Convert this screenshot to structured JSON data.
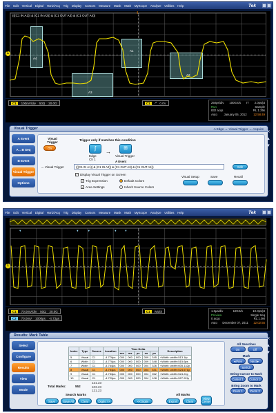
{
  "menu": {
    "items": [
      "File",
      "Edit",
      "Vertical",
      "Digital",
      "Horiz/Acq",
      "Trig",
      "Display",
      "Cursors",
      "Measure",
      "Mask",
      "Math",
      "MyScope",
      "Analyze",
      "Utilities",
      "Help"
    ],
    "brand": "Tek"
  },
  "screen1": {
    "expression": "(((C1 IN A1)) & (C1 IN A2)) & (C1 OUT A3) & (C1 OUT A4))",
    "areas": {
      "a4": "A4",
      "a3": "A3",
      "a1": "A1",
      "a2": "A2",
      "a2_label": "A2"
    },
    "ch": {
      "badge": "C1",
      "scale": "100mV/div",
      "imp": "50Ω",
      "bw": "20.0G"
    },
    "trig": {
      "badge": "C1",
      "slope": "↗",
      "level": "0.0V"
    },
    "acq": {
      "rate": "250ps/div",
      "sps": "100GS/s",
      "pts": "IT",
      "ptpt": "2.0ps/pt",
      "state": "Run",
      "mode": "Sample",
      "acqs": "832 acqs",
      "rl": "RL:1.25k",
      "auto": "Auto",
      "date": "January 06, 2012",
      "time": "12:58:49"
    },
    "dialog": {
      "title": "Visual Trigger",
      "crumb": "A Edge → Visual Trigger → Acquire",
      "tabs": [
        "A Event",
        "A→B Seq",
        "B Event",
        "Visual Trigger",
        "Options"
      ],
      "vt_label": "Visual Trigger",
      "vt_state": "On",
      "instruction": "Trigger only if matches this condition",
      "aevent": "A Event",
      "edge": "Edge",
      "edge_ch": "Ch 1",
      "vt_btn": "Visual Trigger",
      "arrow_label": "→ Visual Trigger",
      "expr_field": "(((C1 IN A1)) & (C1 IN A2)) & (C1 OUT A3) & (C1 OUT A4))",
      "edit": "Edit",
      "display_chk": "Display Visual Trigger on Screen",
      "trig_expr": "Trig Expression",
      "area_settings": "Area Settings",
      "default_colors": "Default Colors",
      "inherit_colors": "Inherit Source Colors",
      "setup": "Visual Setup",
      "save": "Save",
      "recall": "Recall"
    }
  },
  "screen2": {
    "ch": {
      "badge": "C1",
      "scale": "70.0mV/div",
      "imp": "50Ω",
      "bw": "20.0G"
    },
    "ch2": {
      "badge": "C2",
      "scale": "70.0mV",
      "rate": "1000ps",
      "offset": "-4.73µs"
    },
    "trig": {
      "badge": "C1",
      "mode": "Width"
    },
    "acq": {
      "rate": "1.0µs/div",
      "sps": "10GS/s",
      "ptpt": "10.0ps/pt",
      "state": "Preview",
      "mode": "Single Seq",
      "acqs": "0 acqs",
      "rl": "RL:1.0M",
      "auto": "Auto",
      "date": "December 07, 2011",
      "time": "12:02:55"
    },
    "dialog": {
      "title": "Results: Mark Table",
      "tabs": [
        "Select",
        "Configure",
        "Results",
        "View",
        "Mode"
      ],
      "table": {
        "headers": [
          "Index",
          "Type",
          "Source",
          "Location",
          "Time Delta",
          "Description"
        ],
        "sub": [
          "sec",
          "ms",
          "µs",
          "ns",
          "ps"
        ],
        "rows": [
          {
            "i": "5",
            "type": "Visual",
            "src": "C1",
            "loc": "-4.779µs",
            "d": [
              "000",
              "000",
              "000",
              "009",
              "345"
            ],
            "desc": "<Width: width<513.1fp"
          },
          {
            "i": "6",
            "type": "Width",
            "src": "C1",
            "loc": "-4.770µs",
            "d": [
              "000",
              "000",
              "000",
              "009",
              "348"
            ],
            "desc": "<Width: width<515.6ps"
          },
          {
            "i": "7",
            "type": "Width",
            "src": "C1",
            "loc": "-4.764µs",
            "d": [
              "000",
              "000",
              "000",
              "004",
              "326"
            ],
            "desc": "<Width: width<605.132p"
          },
          {
            "i": "8",
            "type": "Visual",
            "src": "C1",
            "loc": "-4.754µs",
            "d": [
              "000",
              "000",
              "000",
              "004",
              "331"
            ],
            "desc": "<Width: width<524.671p"
          },
          {
            "i": "9",
            "type": "Visual",
            "src": "C1",
            "loc": "-4.733µs",
            "d": [
              "000",
              "000",
              "000",
              "004",
              "062"
            ],
            "desc": "<Width: width<524.24p"
          },
          {
            "i": "10",
            "type": "Visual",
            "src": "C1",
            "loc": "-4.729µs",
            "d": [
              "000",
              "000",
              "000",
              "004",
              "108"
            ],
            "desc": "<Width: width<527.92fp"
          }
        ],
        "extra": [
          "121.23",
          "103.23",
          "121.23"
        ]
      },
      "total_label": "Total Marks:",
      "total": "552",
      "search_marks": "Search Marks",
      "save": "Save",
      "save_all": "Save All",
      "clear": "Clear",
      "digits_minus": "Digits >>",
      "digits_plus": "<<Digits",
      "all_marks": "All Marks",
      "export": "Export",
      "clear2": "Clear",
      "view_center": "View Center",
      "all_searches": "All Searches",
      "on": "On",
      "off": "Off",
      "mark": "Mark",
      "prev": "◄Prev",
      "next": "Next►",
      "setclr": "Set/Clr",
      "bring_cursor": "Bring Cursor to Mark",
      "cursor1": "Cursor 1",
      "cursor2": "Cursor 2",
      "bring_zoom": "Bring Zoom to Mark",
      "zoom1": "Zoom 1",
      "zoom2": "Zoom 2"
    }
  }
}
